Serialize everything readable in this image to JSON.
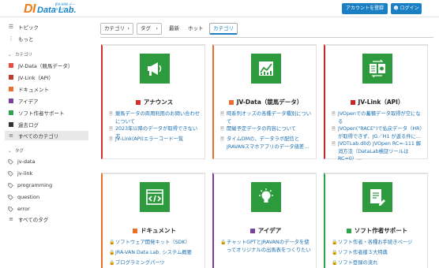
{
  "header": {
    "logo_mark": "DI",
    "logo_text": "Data Lab.",
    "logo_tag": "JRA-VAN データラボ",
    "register_button": "アカウントを登録",
    "login_button": "ログイン"
  },
  "sidebar": {
    "top_items": [
      {
        "label": "トピック",
        "icon": "list-icon"
      },
      {
        "label": "もっと",
        "icon": "more-icon"
      }
    ],
    "category_heading": "カテゴリ",
    "categories": [
      {
        "label": "JV-Data（競馬データ）",
        "color": "#e74c3c"
      },
      {
        "label": "JV-Link（API）",
        "color": "#c0392b"
      },
      {
        "label": "ドキュメント",
        "color": "#e8702a"
      },
      {
        "label": "アイデア",
        "color": "#7b3f9e"
      },
      {
        "label": "ソフト作者サポート",
        "color": "#2ea54a"
      },
      {
        "label": "過去ログ",
        "color": "#333333"
      }
    ],
    "all_categories": "すべてのカテゴリ",
    "tags_heading": "タグ",
    "tags": [
      "jv-data",
      "jv-link",
      "programming",
      "question",
      "error"
    ],
    "all_tags": "すべてのタグ"
  },
  "filters": {
    "category_dropdown": "カテゴリ",
    "tag_dropdown": "タグ",
    "tabs": [
      "最新",
      "ホット",
      "カテゴリ"
    ]
  },
  "cards": [
    {
      "title": "アナウンス",
      "accent": "#d32f2f",
      "icon_bg": "#2e9a3e",
      "icon": "megaphone-icon",
      "links": [
        "競馬データの商用利用のお問い合わせについて",
        "2023年以降のデータが取得できない方",
        "JV-Link(API)エラーコード一覧"
      ]
    },
    {
      "title": "JV-Data（競馬データ）",
      "accent": "#e8702a",
      "icon_bg": "#2e9a3e",
      "icon": "chart-icon",
      "links": [
        "時系列オッズの各種データ種別について",
        "開催予定データの内容について",
        "タイムDMの、データラボ配信とJRAVANスマホアプリのデータ値差…"
      ]
    },
    {
      "title": "JV-Link（API）",
      "accent": "#c62828",
      "icon_bg": "#2e9a3e",
      "icon": "exchange-icon",
      "links": [
        "JVOpenでの蓄積データ取得が空になる",
        "JVOpen(\"RACE\")で払戻データ（HR）が取得できず、JG／H1 が返る件に…",
        "JVDTLab.dllの JVOpen RC=-111 解消方法（DataLab検証ツールは RC=0）…"
      ]
    },
    {
      "title": "ドキュメント",
      "accent": "#e8702a",
      "icon_bg": "#2e9a3e",
      "icon": "code-icon",
      "links": [
        "ソフトウェア開発キット（SDK）",
        "JRA-VAN Data Lab. システム概要",
        "プログラミングパーツ"
      ]
    },
    {
      "title": "アイデア",
      "accent": "#7b3f9e",
      "icon_bg": "#2e9a3e",
      "icon": "lightbulb-icon",
      "links": [
        "チャットGPTとJRAVANのデータを使ってオリジナルの出馬表をつくりたい"
      ]
    },
    {
      "title": "ソフト作者サポート",
      "accent": "#2ea54a",
      "icon_bg": "#2e9a3e",
      "icon": "support-icon",
      "links": [
        "ソフト作者・各種お手続きページ",
        "ソフト作者様３大特典",
        "ソフト登録の流れ"
      ]
    }
  ]
}
